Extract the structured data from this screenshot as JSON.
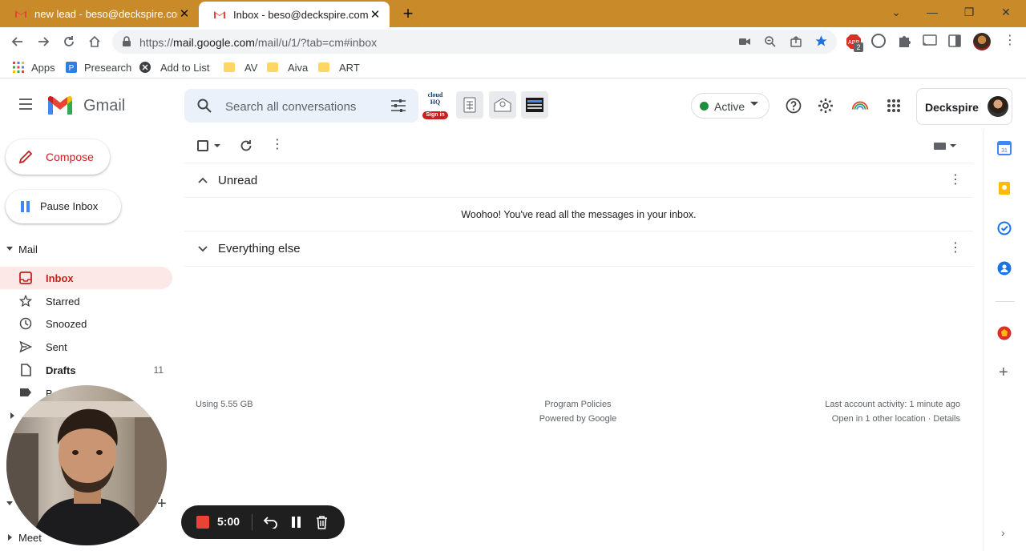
{
  "browser": {
    "tabs": [
      {
        "title": "new lead - beso@deckspire.com",
        "active": false
      },
      {
        "title": "Inbox - beso@deckspire.com - D",
        "active": true
      }
    ],
    "url_prefix": "https://",
    "url_host": "mail.google.com",
    "url_path": "/mail/u/1/?tab=cm#inbox",
    "extension_badge": "2",
    "bookmarks": [
      {
        "label": "Apps",
        "icon": "apps-grid-icon"
      },
      {
        "label": "Presearch",
        "icon": "presearch-icon"
      },
      {
        "label": "Add to List",
        "icon": "globe-icon"
      },
      {
        "label": "AV",
        "icon": "folder-icon"
      },
      {
        "label": "Aiva",
        "icon": "folder-icon"
      },
      {
        "label": "ART",
        "icon": "folder-icon"
      }
    ]
  },
  "gmail": {
    "logo_text": "Gmail",
    "search_placeholder": "Search all conversations",
    "cloudhq_label": "cloud HQ",
    "cloudhq_signin": "Sign in",
    "status": "Active",
    "account_name": "Deckspire",
    "accent": "#c5221f"
  },
  "sidebar": {
    "compose": "Compose",
    "pause": "Pause Inbox",
    "mail_header": "Mail",
    "items": [
      {
        "label": "Inbox",
        "icon": "inbox-icon",
        "active": true,
        "count": ""
      },
      {
        "label": "Starred",
        "icon": "star-icon",
        "active": false,
        "count": ""
      },
      {
        "label": "Snoozed",
        "icon": "clock-icon",
        "active": false,
        "count": ""
      },
      {
        "label": "Sent",
        "icon": "send-icon",
        "active": false,
        "count": ""
      },
      {
        "label": "Drafts",
        "icon": "draft-icon",
        "active": false,
        "count": "11"
      },
      {
        "label": "B",
        "icon": "label-icon",
        "active": false,
        "count": ""
      }
    ],
    "meet": "Meet"
  },
  "main": {
    "sections": [
      {
        "title": "Unread",
        "expanded": true,
        "empty_message": "Woohoo! You've read all the messages in your inbox."
      },
      {
        "title": "Everything else",
        "expanded": false
      }
    ],
    "footer": {
      "storage": "Using 5.55 GB",
      "policies": "Program Policies",
      "powered": "Powered by Google",
      "activity": "Last account activity: 1 minute ago",
      "other_location": "Open in 1 other location · Details"
    }
  },
  "recorder": {
    "time": "5:00"
  }
}
